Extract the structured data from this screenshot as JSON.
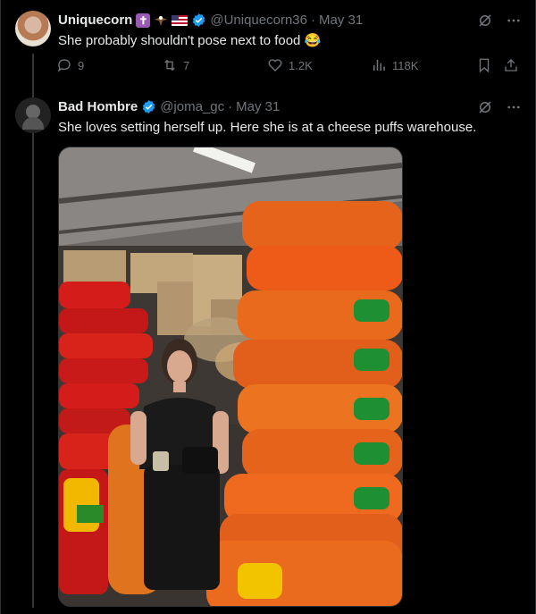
{
  "tweets": [
    {
      "display_name": "Uniquecorn",
      "handle": "@Uniquecorn36",
      "separator": "·",
      "date": "May 31",
      "text": "She probably shouldn't pose next to food 😂",
      "replies": "9",
      "reposts": "7",
      "likes": "1.2K",
      "views": "118K"
    },
    {
      "display_name": "Bad Hombre",
      "handle": "@joma_gc",
      "separator": "·",
      "date": "May 31",
      "text": "She loves setting herself up. Here she is at a cheese puffs warehouse."
    }
  ],
  "icons": {
    "grok": "grok-icon",
    "more": "more-options-icon",
    "reply": "reply-icon",
    "repost": "repost-icon",
    "like": "like-icon",
    "views": "views-icon",
    "bookmark": "bookmark-icon",
    "share": "share-icon",
    "verified": "verified-badge-icon"
  },
  "colors": {
    "background": "#000000",
    "text": "#e7e9ea",
    "secondary": "#71767b",
    "verified": "#1d9bf0",
    "divider": "#2f3336"
  }
}
